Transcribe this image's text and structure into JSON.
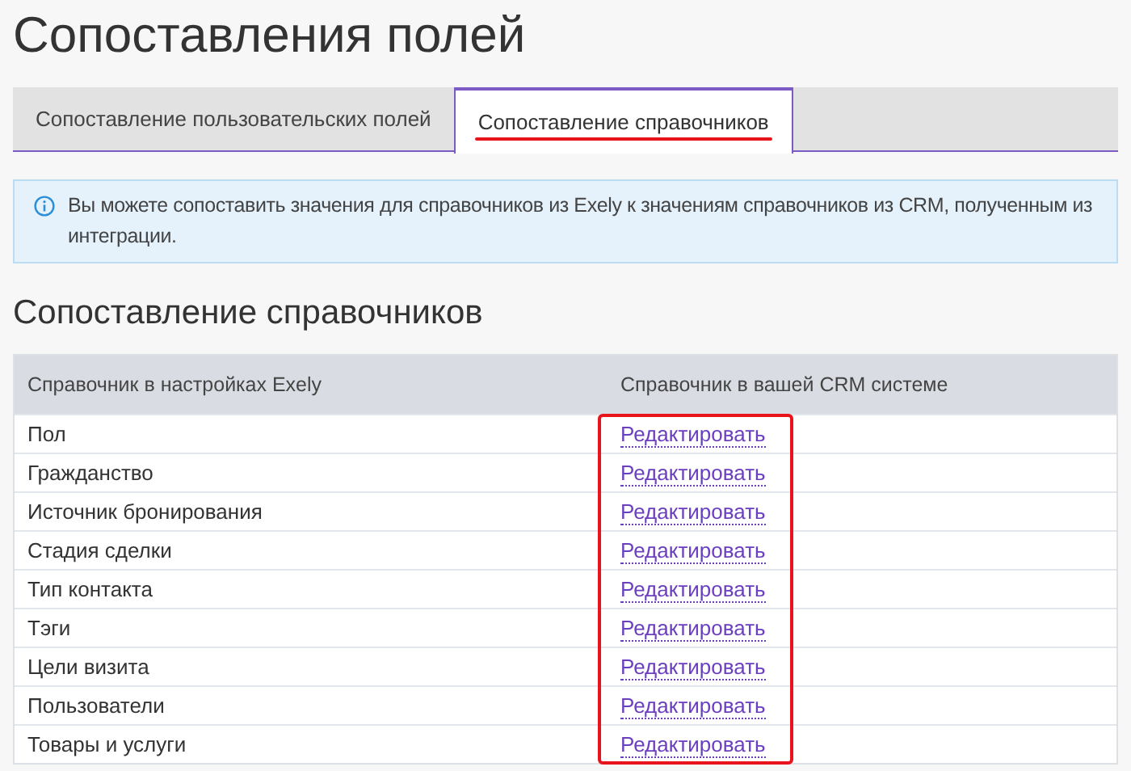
{
  "page_title": "Сопоставления полей",
  "tabs": [
    {
      "label": "Сопоставление пользовательских полей",
      "selected": false
    },
    {
      "label": "Сопоставление справочников",
      "selected": true
    }
  ],
  "info": "Вы можете сопоставить значения для справочников из Exely к значениям справочников из CRM, полученным из интеграции.",
  "section_title": "Сопоставление справочников",
  "table": {
    "columns": [
      "Справочник в настройках Exely",
      "Справочник в вашей CRM системе"
    ],
    "rows": [
      {
        "name": "Пол",
        "link": "Редактировать"
      },
      {
        "name": "Гражданство",
        "link": "Редактировать"
      },
      {
        "name": "Источник бронирования",
        "link": "Редактировать"
      },
      {
        "name": "Стадия сделки",
        "link": "Редактировать"
      },
      {
        "name": "Тип контакта",
        "link": "Редактировать"
      },
      {
        "name": "Тэги",
        "link": "Редактировать"
      },
      {
        "name": "Цели визита",
        "link": "Редактировать"
      },
      {
        "name": "Пользователи",
        "link": "Редактировать"
      },
      {
        "name": "Товары и услуги",
        "link": "Редактировать"
      }
    ]
  },
  "annotations": {
    "selected_tab_underline": true,
    "link_column_frame": true
  }
}
